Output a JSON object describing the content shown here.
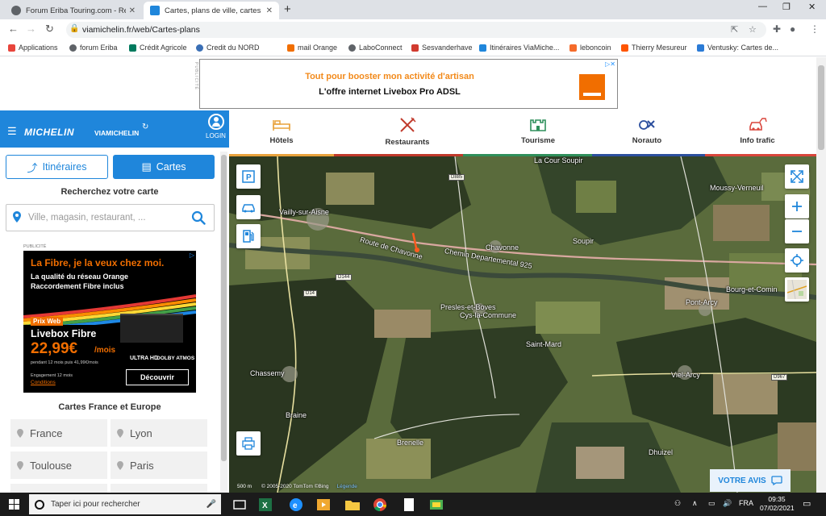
{
  "browser": {
    "tabs": [
      {
        "title": "Forum Eriba Touring.com - Répo",
        "active": false
      },
      {
        "title": "Cartes, plans de ville, cartes rout",
        "active": true
      }
    ],
    "url": "viamichelin.fr/web/Cartes-plans",
    "bookmarks": [
      "Applications",
      "forum Eriba",
      "Crédit Agricole",
      "Credit du NORD",
      "mail Orange",
      "LaboConnect",
      "Sesvanderhave",
      "Itinéraires ViaMiche...",
      "leboncoin",
      "Thierry Mesureur",
      "Ventusky: Cartes de..."
    ]
  },
  "top_ad": {
    "vertical_label": "PUBLICITÉ",
    "line1": "Tout pour booster mon activité d'artisan",
    "line2": "L'offre internet Livebox Pro ADSL"
  },
  "header": {
    "brand": "MICHELIN",
    "brand_sub": "VIAMICHELIN",
    "login": "LOGIN"
  },
  "left_panel": {
    "btn_itineraires": "Itinéraires",
    "btn_cartes": "Cartes",
    "search_title": "Recherchez votre carte",
    "search_placeholder": "Ville, magasin, restaurant, ...",
    "publicite": "PUBLICITÉ",
    "fibre_ad": {
      "title": "La Fibre, je la veux chez moi.",
      "line1": "La qualité du réseau Orange",
      "line2": "Raccordement Fibre inclus",
      "prix_web": "Prix Web",
      "product": "Livebox Fibre",
      "price": "22,99€",
      "per": "/mois",
      "pendant": "pendant 12 mois puis 41,99€/mois",
      "hd": "ULTRA HD",
      "dolby": "DOLBY ATMOS",
      "engagement": "Engagement 12 mois",
      "conditions": "Conditions",
      "cta": "Découvrir"
    },
    "cartes_title": "Cartes France et Europe",
    "cities": [
      "France",
      "Lyon",
      "Toulouse",
      "Paris"
    ]
  },
  "categories": [
    {
      "label": "Hôtels",
      "color": "#e8a23c"
    },
    {
      "label": "Restaurants",
      "color": "#c0392b"
    },
    {
      "label": "Tourisme",
      "color": "#2f8f5b"
    },
    {
      "label": "Norauto",
      "color": "#2c4f9e"
    },
    {
      "label": "Info trafic",
      "color": "#d9453b"
    }
  ],
  "map": {
    "places": [
      "La Cour Soupir",
      "Moussy-Verneuil",
      "Vailly-sur-Aisne",
      "Route de Chavonne",
      "Chemin Departemental 925",
      "Chavonne",
      "Soupir",
      "Bourg-et-Comin",
      "Pont-Arcy",
      "Presles-et-Boves",
      "Cys-la-Commune",
      "Saint-Mard",
      "Chassemy",
      "Viel-Arcy",
      "Braine",
      "Brenelle",
      "Dhuizel"
    ],
    "roads": [
      "D885",
      "D144",
      "D14",
      "D967"
    ],
    "votre_avis": "VOTRE AVIS",
    "scale": "500 m",
    "copyright": "© 2005-2020 TomTom ©Bing",
    "legend": "Légende"
  },
  "taskbar": {
    "search_placeholder": "Taper ici pour rechercher",
    "lang": "FRA",
    "time": "09:35",
    "date": "07/02/2021"
  }
}
